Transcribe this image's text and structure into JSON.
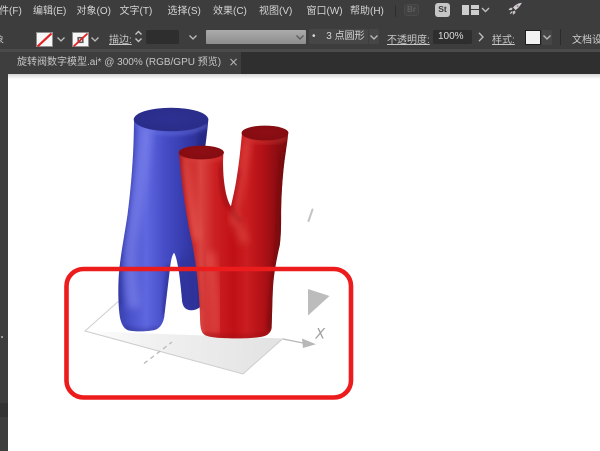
{
  "app": "Adobe Illustrator",
  "menu_bar": {
    "items": [
      {
        "label": "文件(F)"
      },
      {
        "label": "编辑(E)"
      },
      {
        "label": "对象(O)"
      },
      {
        "label": "文字(T)"
      },
      {
        "label": "选择(S)"
      },
      {
        "label": "效果(C)"
      },
      {
        "label": "视图(V)"
      },
      {
        "label": "窗口(W)"
      },
      {
        "label": "帮助(H)"
      }
    ],
    "icons": [
      {
        "name": "bridge-icon",
        "label": "Br"
      },
      {
        "name": "adobe-stock-icon",
        "label": "St"
      },
      {
        "name": "workspace-switcher-icon"
      },
      {
        "name": "chevron-down-icon"
      },
      {
        "name": "rocket-share-icon"
      }
    ]
  },
  "control_bar": {
    "selection_kind": "象",
    "fill_swatch": "none",
    "stroke_swatch": "none",
    "stroke_label": "描边:",
    "brush_bullet": "•",
    "brush_value": "3 点圆形",
    "opacity_label": "不透明度:",
    "opacity_value": "100%",
    "style_label": "样式:",
    "document_setup_label": "文档设置"
  },
  "document_tab": {
    "title": "旋转阀数字模型.ai* @ 300% (RGB/GPU 预览)",
    "close": "×"
  },
  "canvas": {
    "axis_x_label": "X",
    "annotation": "red rounded rectangle highlight",
    "model": "blue and red Y-shaped 3D tubes on ground plane"
  },
  "colors": {
    "ui_bar": "#3d3d3d",
    "tab_bar": "#2f2f2f",
    "annotation_red": "#ec1c1c",
    "tube_blue": "#4247c2",
    "tube_blue_cap": "#2d3090",
    "tube_red": "#c41217",
    "tube_red_cap": "#8d0e14",
    "plane_gray": "#e7e7e7"
  }
}
